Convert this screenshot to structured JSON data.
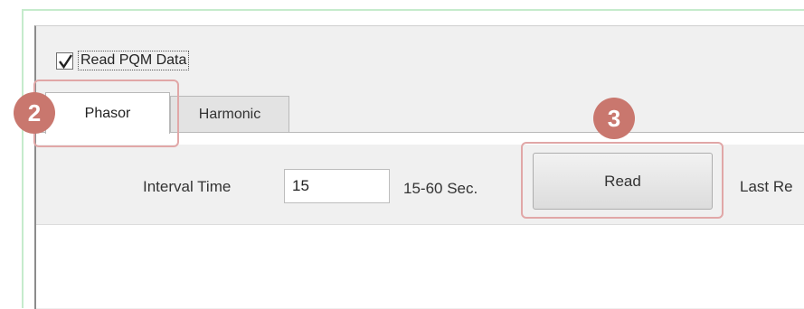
{
  "read_pqm": {
    "label": "Read PQM Data",
    "checked": true
  },
  "tabs": [
    {
      "label": "Phasor",
      "selected": true
    },
    {
      "label": "Harmonic",
      "selected": false
    }
  ],
  "interval": {
    "label": "Interval Time",
    "value": "15",
    "range_label": "15-60  Sec."
  },
  "read_button": {
    "label": "Read"
  },
  "last_read": {
    "label": "Last Re"
  },
  "annotations": [
    {
      "number": "2",
      "target": "tab-phasor"
    },
    {
      "number": "3",
      "target": "read-button"
    }
  ],
  "colors": {
    "badge": "#c9776e",
    "highlight": "#e1a7a7"
  }
}
